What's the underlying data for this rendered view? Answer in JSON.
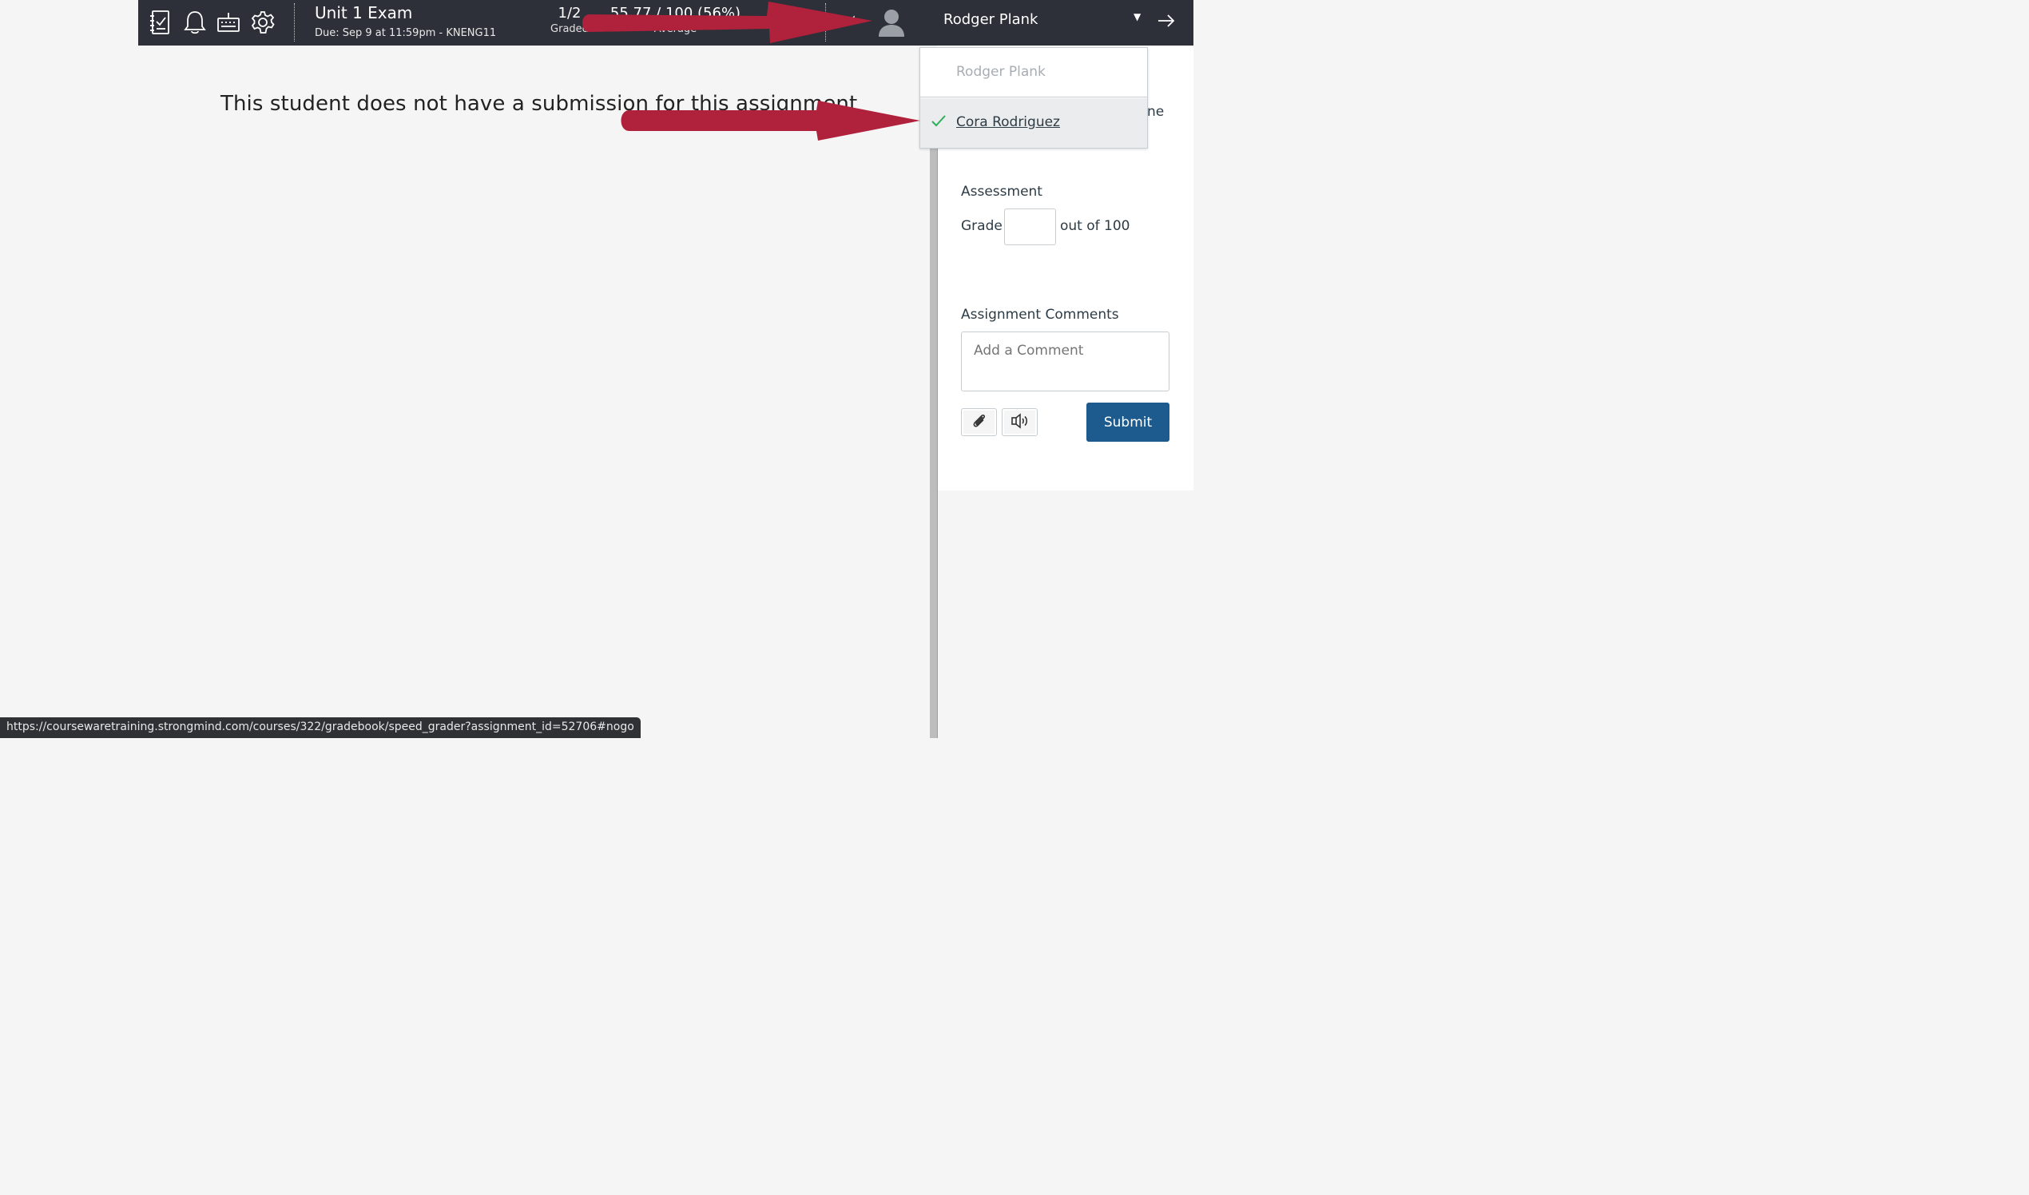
{
  "header": {
    "assignment_title": "Unit 1 Exam",
    "due_text": "Due: Sep 9 at 11:59pm - KNENG11",
    "stats": [
      {
        "value": "1/2",
        "label": "Graded"
      },
      {
        "value": "55.77 / 100 (56%)",
        "label": "Average"
      },
      {
        "value": "",
        "label": "St..."
      }
    ],
    "prev_label": "‹",
    "student_name": "Rodger Plank",
    "caret": "▼",
    "icons": [
      "gradebook-icon",
      "bell-icon",
      "keyboard-icon",
      "gear-icon",
      "avatar-icon",
      "next-arrow-icon"
    ]
  },
  "main": {
    "no_submission_message": "This student does not have a submission for this assignment"
  },
  "student_dropdown": {
    "items": [
      {
        "name": "Rodger Plank",
        "selected": false
      },
      {
        "name": "Cora Rodriguez",
        "selected": true
      }
    ]
  },
  "panel": {
    "partial_text": "ne",
    "assessment_label": "Assessment",
    "grade_label": "Grade",
    "grade_value": "",
    "out_of_text": "out of 100",
    "comments_label": "Assignment Comments",
    "comment_placeholder": "Add a Comment",
    "submit_label": "Submit",
    "icons": [
      "paperclip-icon",
      "speaker-icon"
    ]
  },
  "status_bar": {
    "url": "https://coursewaretraining.strongmind.com/courses/322/gradebook/speed_grader?assignment_id=52706#nogo"
  },
  "colors": {
    "header_bg": "#2d3038",
    "arrow_red": "#b0213c",
    "submit_bg": "#1d5a8e",
    "check_green": "#2eae5a"
  }
}
